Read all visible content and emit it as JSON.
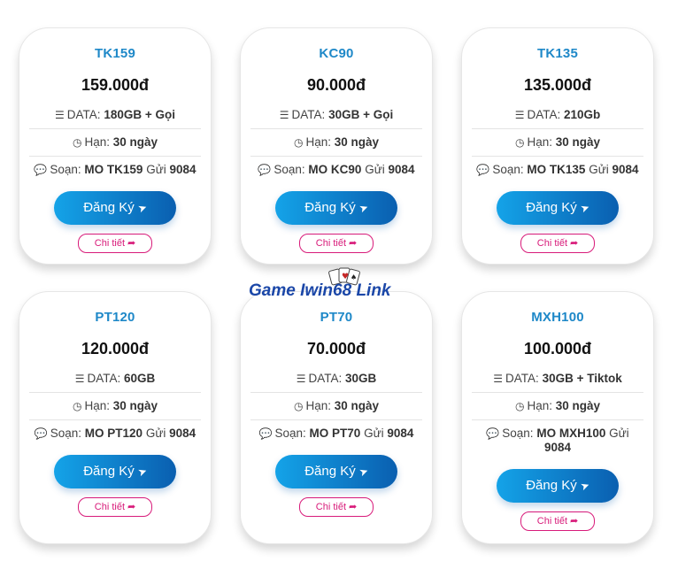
{
  "packages": [
    {
      "name": "TK159",
      "price": "159.000đ",
      "data_label": "DATA:",
      "data_value": "180GB + Gọi",
      "term_label": "Hạn:",
      "term_value": "30 ngày",
      "sms_label": "Soạn:",
      "sms_code": "MO TK159",
      "sms_send": "Gửi",
      "sms_number": "9084",
      "register": "Đăng Ký",
      "detail": "Chi tiết"
    },
    {
      "name": "KC90",
      "price": "90.000đ",
      "data_label": "DATA:",
      "data_value": "30GB + Gọi",
      "term_label": "Hạn:",
      "term_value": "30 ngày",
      "sms_label": "Soạn:",
      "sms_code": "MO KC90",
      "sms_send": "Gửi",
      "sms_number": "9084",
      "register": "Đăng Ký",
      "detail": "Chi tiết"
    },
    {
      "name": "TK135",
      "price": "135.000đ",
      "data_label": "DATA:",
      "data_value": "210Gb",
      "term_label": "Hạn:",
      "term_value": "30 ngày",
      "sms_label": "Soạn:",
      "sms_code": "MO TK135",
      "sms_send": "Gửi",
      "sms_number": "9084",
      "register": "Đăng Ký",
      "detail": "Chi tiết"
    },
    {
      "name": "PT120",
      "price": "120.000đ",
      "data_label": "DATA:",
      "data_value": "60GB",
      "term_label": "Hạn:",
      "term_value": "30 ngày",
      "sms_label": "Soạn:",
      "sms_code": "MO PT120",
      "sms_send": "Gửi",
      "sms_number": "9084",
      "register": "Đăng Ký",
      "detail": "Chi tiết"
    },
    {
      "name": "PT70",
      "price": "70.000đ",
      "data_label": "DATA:",
      "data_value": "30GB",
      "term_label": "Hạn:",
      "term_value": "30 ngày",
      "sms_label": "Soạn:",
      "sms_code": "MO PT70",
      "sms_send": "Gửi",
      "sms_number": "9084",
      "register": "Đăng Ký",
      "detail": "Chi tiết"
    },
    {
      "name": "MXH100",
      "price": "100.000đ",
      "data_label": "DATA:",
      "data_value": "30GB + Tiktok",
      "term_label": "Hạn:",
      "term_value": "30 ngày",
      "sms_label": "Soạn:",
      "sms_code": "MO MXH100",
      "sms_send": "Gửi",
      "sms_number": "9084",
      "register": "Đăng Ký",
      "detail": "Chi tiết"
    }
  ],
  "watermark": {
    "text": "Game Iwin68 Link"
  },
  "icons": {
    "data": "database-icon",
    "term": "clock-icon",
    "sms": "comment-icon",
    "register": "paper-plane-icon",
    "detail": "share-icon"
  },
  "colors": {
    "accent": "#1e88c8",
    "button_start": "#14a3e8",
    "button_end": "#0a5fb0",
    "detail": "#d81b7a"
  }
}
